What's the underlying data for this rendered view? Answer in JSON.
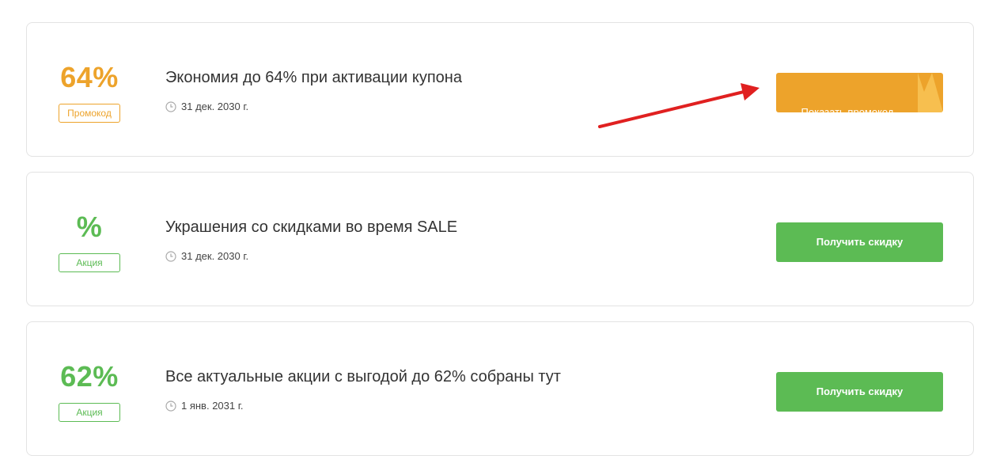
{
  "colors": {
    "promo_orange": "#eda32b",
    "promo_fold": "#f7bf4f",
    "deal_green": "#5cbb54",
    "arrow_red": "#e02020"
  },
  "offers": [
    {
      "discount": "64%",
      "badge": "Промокод",
      "title": "Экономия до 64% при активации купона",
      "date": "31 дек. 2030 г.",
      "button": "Показать промокод",
      "kind": "promo"
    },
    {
      "discount": "%",
      "badge": "Акция",
      "title": "Украшения со скидками во время SALE",
      "date": "31 дек. 2030 г.",
      "button": "Получить скидку",
      "kind": "deal"
    },
    {
      "discount": "62%",
      "badge": "Акция",
      "title": "Все актуальные акции с выгодой до 62% собраны тут",
      "date": "1 янв. 2031 г.",
      "button": "Получить скидку",
      "kind": "deal"
    }
  ]
}
